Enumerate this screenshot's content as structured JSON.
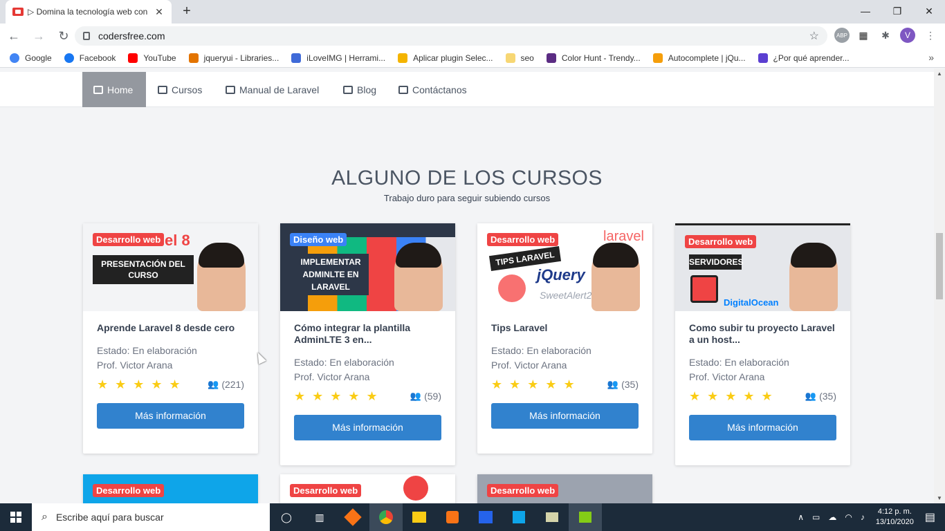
{
  "browser": {
    "tab_title": "▷ Domina la tecnología web con",
    "tab_close": "✕",
    "new_tab": "+",
    "window_controls": [
      "—",
      "❐",
      "✕"
    ],
    "url": "codersfree.com",
    "profile_initial": "V",
    "bookmarks": [
      {
        "label": "Google",
        "color": "#4285f4"
      },
      {
        "label": "Facebook",
        "color": "#1877f2"
      },
      {
        "label": "YouTube",
        "color": "#ff0000"
      },
      {
        "label": "jqueryui - Libraries...",
        "color": "#e37400"
      },
      {
        "label": "iLoveIMG | Herrami...",
        "color": "#3f6ad8"
      },
      {
        "label": "Aplicar plugin Selec...",
        "color": "#f4b400"
      },
      {
        "label": "seo",
        "color": "#f7d774"
      },
      {
        "label": "Color Hunt - Trendy...",
        "color": "#5b2c83"
      },
      {
        "label": "Autocomplete | jQu...",
        "color": "#f59e0b"
      },
      {
        "label": "¿Por qué aprender...",
        "color": "#5b3fd1"
      }
    ],
    "bookmarks_more": "»"
  },
  "site": {
    "nav": [
      {
        "label": "Home",
        "active": true
      },
      {
        "label": "Cursos",
        "active": false
      },
      {
        "label": "Manual de Laravel",
        "active": false
      },
      {
        "label": "Blog",
        "active": false
      },
      {
        "label": "Contáctanos",
        "active": false
      }
    ],
    "section_title": "ALGUNO DE LOS CURSOS",
    "section_subtitle": "Trabajo duro para seguir subiendo cursos",
    "courses": [
      {
        "badge": "Desarrollo web",
        "badge_color": "#ef4444",
        "thumb_caption": "PRESENTACIÓN DEL CURSO",
        "thumb_brand": "el 8",
        "title": "Aprende Laravel 8 desde cero",
        "status": "Estado: En elaboración",
        "author": "Prof. Victor Arana",
        "stars": "★★★★★",
        "users": "(221)",
        "button": "Más información"
      },
      {
        "badge": "Diseño web",
        "badge_color": "#3b82f6",
        "thumb_caption": "IMPLEMENTAR ADMINLTE EN LARAVEL",
        "thumb_brand": "",
        "title": "Cómo integrar la plantilla AdminLTE 3 en...",
        "status": "Estado: En elaboración",
        "author": "Prof. Victor Arana",
        "stars": "★★★★★",
        "users": "(59)",
        "button": "Más información"
      },
      {
        "badge": "Desarrollo web",
        "badge_color": "#ef4444",
        "thumb_caption": "TIPS LARAVEL",
        "thumb_brand": "laravel",
        "title": "Tips Laravel",
        "status": "Estado: En elaboración",
        "author": "Prof. Victor Arana",
        "stars": "★★★★★",
        "users": "(35)",
        "button": "Más información"
      },
      {
        "badge": "Desarrollo web",
        "badge_color": "#ef4444",
        "thumb_caption": "SERVIDORES",
        "thumb_brand": "DigitalOcean",
        "title": "Como subir tu proyecto Laravel a un host...",
        "status": "Estado: En elaboración",
        "author": "Prof. Victor Arana",
        "stars": "★★★★★",
        "users": "(35)",
        "button": "Más información"
      }
    ],
    "next_row_badges": [
      "Desarrollo web",
      "Desarrollo web",
      "Desarrollo web"
    ]
  },
  "taskbar": {
    "search_placeholder": "Escribe aquí para buscar",
    "time": "4:12 p. m.",
    "date": "13/10/2020"
  }
}
